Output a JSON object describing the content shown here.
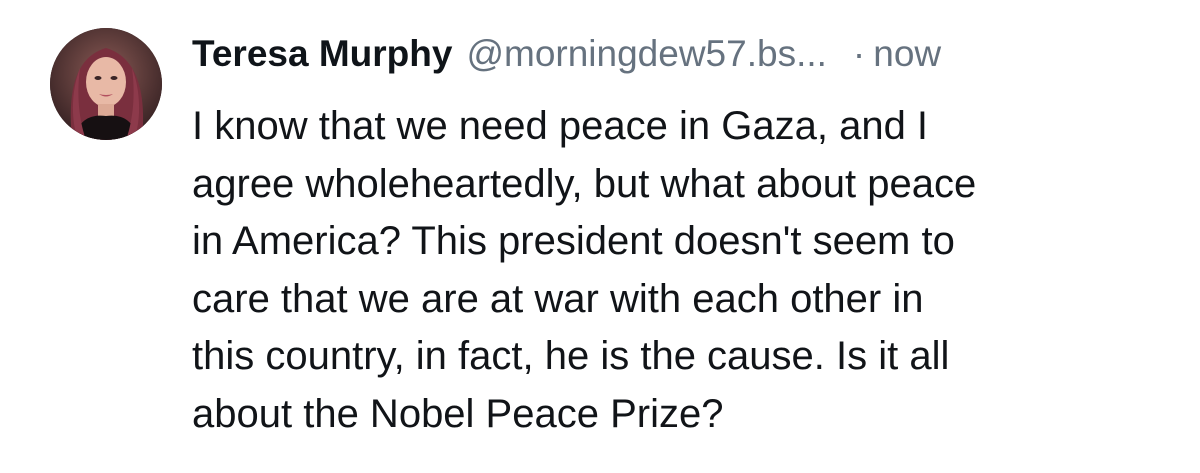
{
  "post": {
    "author": {
      "display_name": "Teresa Murphy",
      "handle": "@morningdew57.bs...",
      "avatar_icon": "profile-photo"
    },
    "separator": "·",
    "timestamp": "now",
    "text": "I know that we need peace in Gaza, and I\nagree wholeheartedly, but what about peace\nin America? This president doesn't seem to\ncare that we are at war with each other in\nthis country, in fact, he is the cause. Is it all\nabout the Nobel Peace Prize?"
  },
  "colors": {
    "primary_text": "#0f1419",
    "secondary_text": "#66727f",
    "background": "#ffffff"
  }
}
